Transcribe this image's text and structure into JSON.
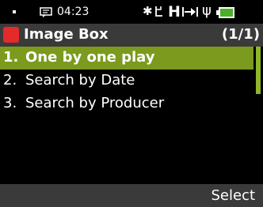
{
  "status_bar": {
    "time": "04:23",
    "icons": [
      "message-icon",
      "bluetooth-icon",
      "signal-icon",
      "hsdpa-icon",
      "hold-icon",
      "usb-icon",
      "battery-icon"
    ],
    "hsdpa_text": "H",
    "battery_color": "#4caf2a"
  },
  "title_bar": {
    "title": "Image Box",
    "count": "(1/1)",
    "icon_color": "#e52a2a"
  },
  "list": {
    "items": [
      {
        "number": "1.",
        "label": "One by one play",
        "selected": true
      },
      {
        "number": "2.",
        "label": "Search by Date",
        "selected": false
      },
      {
        "number": "3.",
        "label": "Search by Producer",
        "selected": false
      }
    ],
    "highlight_color": "#7b9a1e"
  },
  "softkeys": {
    "right": "Select"
  }
}
